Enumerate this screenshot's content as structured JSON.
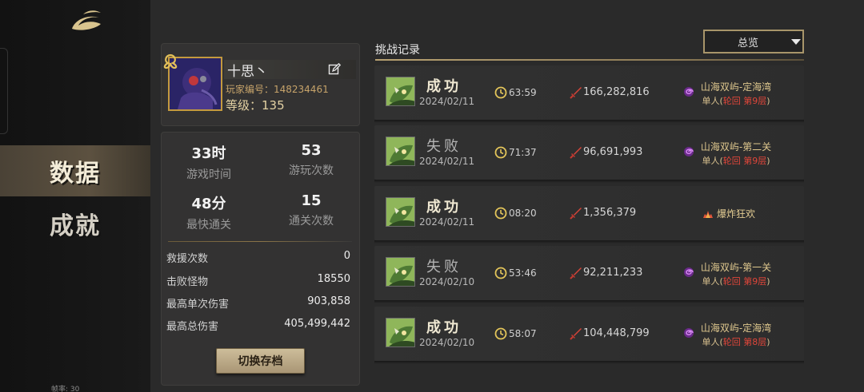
{
  "sidebar": {
    "nav": [
      {
        "label": "数据",
        "active": true
      },
      {
        "label": "成就",
        "active": false
      }
    ],
    "fps_label": "帧率: 30"
  },
  "player": {
    "name": "十思丶",
    "id_label": "玩家编号：148234461",
    "level_label": "等级：135"
  },
  "stats": {
    "big": [
      {
        "value": "33时",
        "label": "游戏时间"
      },
      {
        "value": "53",
        "label": "游玩次数"
      },
      {
        "value": "48分",
        "label": "最快通关"
      },
      {
        "value": "15",
        "label": "通关次数"
      }
    ],
    "rows": [
      {
        "label": "救援次数",
        "value": "0"
      },
      {
        "label": "击败怪物",
        "value": "18550"
      },
      {
        "label": "最高单次伤害",
        "value": "903,858"
      },
      {
        "label": "最高总伤害",
        "value": "405,499,442"
      }
    ],
    "switch_button": "切换存档"
  },
  "records": {
    "title": "挑战记录",
    "filter": {
      "selected": "总览"
    },
    "items": [
      {
        "result": "成功",
        "win": true,
        "date": "2024/02/11",
        "time": "63:59",
        "damage": "166,282,816",
        "stage": "山海双屿-定海湾",
        "mode_prefix": "单人(",
        "mode_highlight": "轮回 第9层",
        "mode_suffix": ")"
      },
      {
        "result": "失败",
        "win": false,
        "date": "2024/02/11",
        "time": "71:37",
        "damage": "96,691,993",
        "stage": "山海双屿-第二关",
        "mode_prefix": "单人(",
        "mode_highlight": "轮回 第9层",
        "mode_suffix": ")"
      },
      {
        "result": "成功",
        "win": true,
        "date": "2024/02/11",
        "time": "08:20",
        "damage": "1,356,379",
        "event": "爆炸狂欢"
      },
      {
        "result": "失败",
        "win": false,
        "date": "2024/02/10",
        "time": "53:46",
        "damage": "92,211,233",
        "stage": "山海双屿-第一关",
        "mode_prefix": "单人(",
        "mode_highlight": "轮回 第9层",
        "mode_suffix": ")"
      },
      {
        "result": "成功",
        "win": true,
        "date": "2024/02/10",
        "time": "58:07",
        "damage": "104,448,799",
        "stage": "山海双屿-定海湾",
        "mode_prefix": "单人(",
        "mode_highlight": "轮回 第8层",
        "mode_suffix": ")"
      }
    ]
  },
  "colors": {
    "accent_gold": "#c49a3e",
    "mode_red": "#e0463a",
    "swirl_purple": "#b44ce0"
  },
  "icons": [
    "game-logo-icon",
    "edit-icon",
    "clock-icon",
    "sword-icon",
    "swirl-icon",
    "flame-icon",
    "caret-down-icon"
  ]
}
